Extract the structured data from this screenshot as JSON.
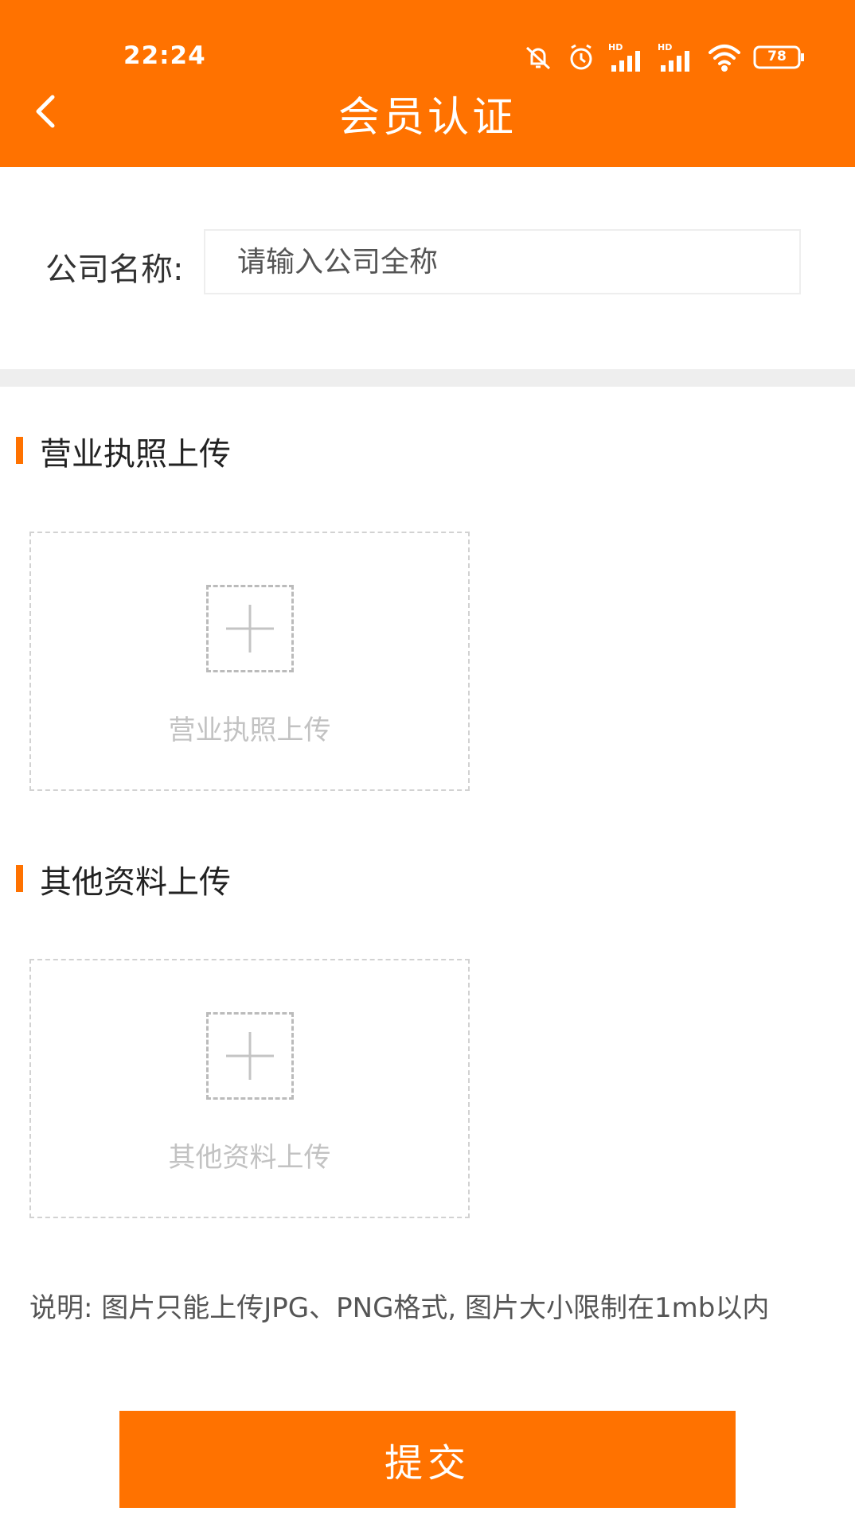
{
  "status_bar": {
    "time": "22:24",
    "battery": "78",
    "icons": [
      "mute-icon",
      "alarm-icon",
      "signal-hd-1-icon",
      "signal-hd-2-icon",
      "wifi-icon",
      "battery-icon"
    ]
  },
  "header": {
    "title": "会员认证",
    "back_icon": "chevron-left-icon",
    "background": "#FF7200"
  },
  "company": {
    "label": "公司名称:",
    "placeholder": "请输入公司全称",
    "value": ""
  },
  "sections": [
    {
      "title": "营业执照上传",
      "upload_label": "营业执照上传"
    },
    {
      "title": "其他资料上传",
      "upload_label": "其他资料上传"
    }
  ],
  "note": "说明: 图片只能上传JPG、PNG格式, 图片大小限制在1mb以内",
  "submit_label": "提交",
  "colors": {
    "accent": "#FF7200",
    "divider": "#EEEEEE"
  }
}
